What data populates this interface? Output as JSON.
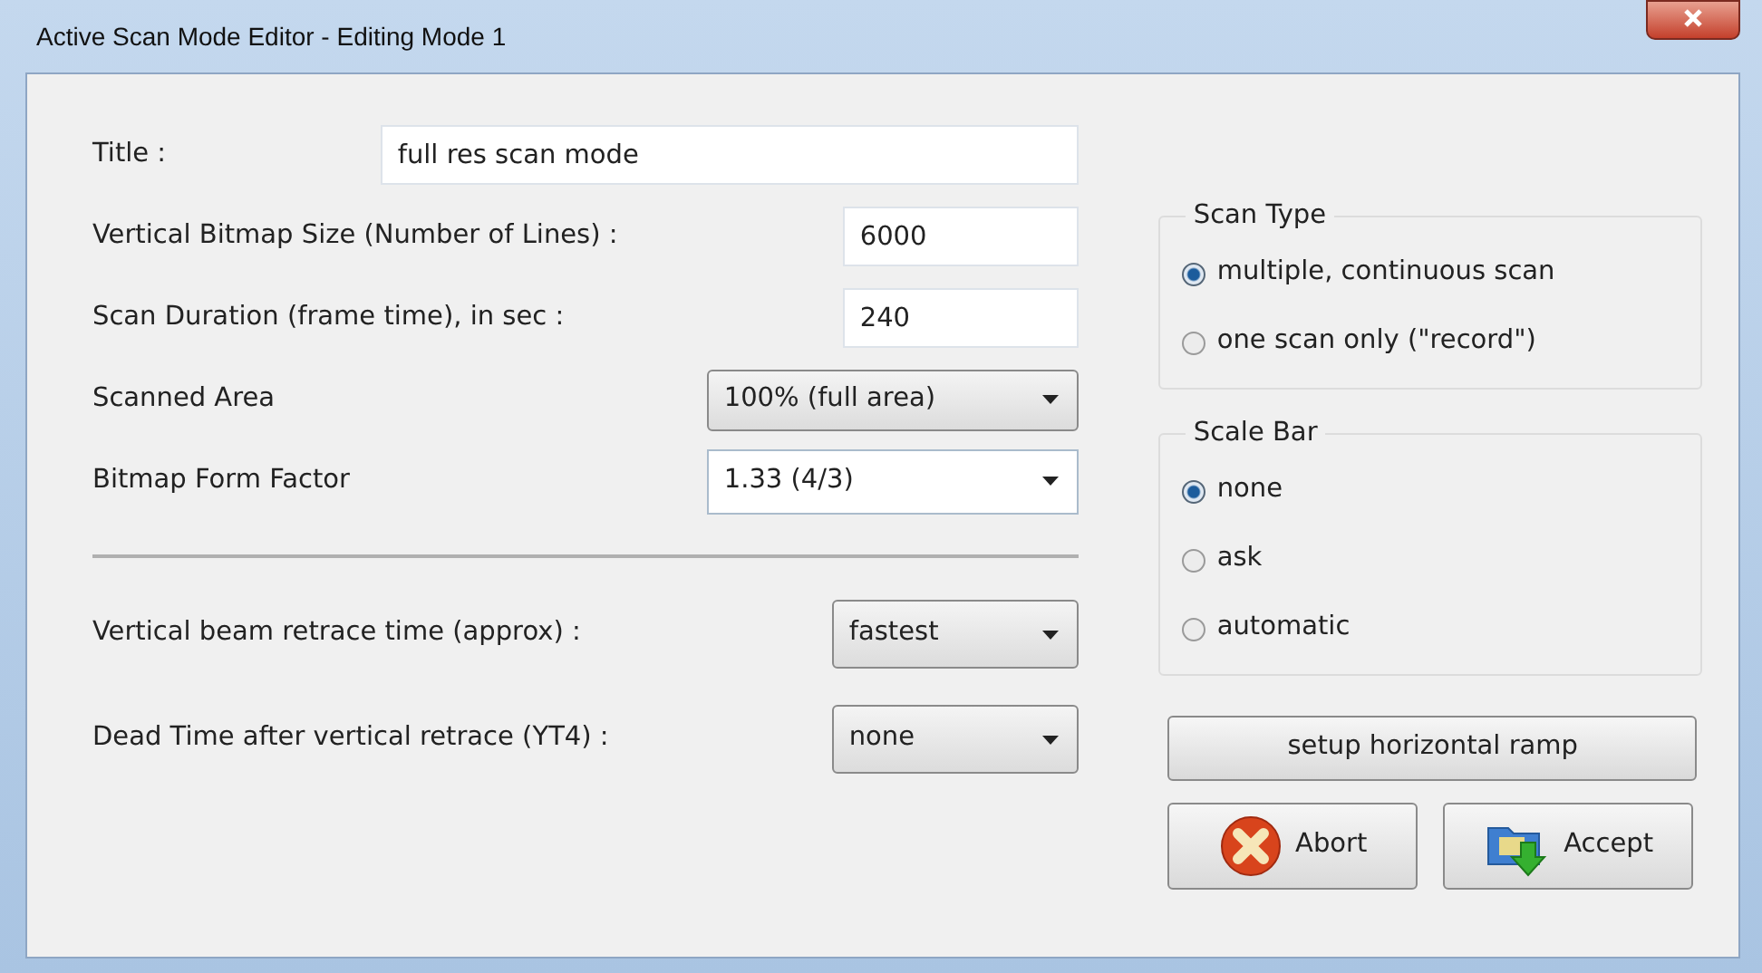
{
  "window": {
    "title": "Active Scan Mode Editor - Editing Mode 1"
  },
  "fields": [
    {
      "kind": "text",
      "label": "Title :",
      "value": "full res scan mode"
    },
    {
      "kind": "number",
      "label": "Vertical Bitmap Size (Number of Lines) :",
      "value": "6000"
    },
    {
      "kind": "number",
      "label": "Scan Duration (frame time), in sec  :",
      "value": "240"
    },
    {
      "kind": "dropdown",
      "label": "Scanned Area",
      "value": "100% (full area)"
    },
    {
      "kind": "combo",
      "label": "Bitmap Form Factor",
      "value": "1.33 (4/3)"
    }
  ],
  "retrace": [
    {
      "kind": "dropdown",
      "label": "Vertical beam retrace time (approx) :",
      "value": "fastest"
    },
    {
      "kind": "dropdown",
      "label": "Dead Time after vertical retrace (YT4) :",
      "value": "none"
    }
  ],
  "groups": [
    {
      "title": "Scan Type",
      "options": [
        {
          "label": "multiple, continuous scan",
          "selected": true
        },
        {
          "label": "one scan only (\"record\")",
          "selected": false
        }
      ]
    },
    {
      "title": "Scale Bar",
      "options": [
        {
          "label": "none",
          "selected": true
        },
        {
          "label": "ask",
          "selected": false
        },
        {
          "label": "automatic",
          "selected": false
        }
      ]
    }
  ],
  "setup_button": "setup horizontal ramp",
  "buttons": [
    {
      "kind": "abort",
      "label": "Abort"
    },
    {
      "kind": "accept",
      "label": "Accept"
    }
  ]
}
